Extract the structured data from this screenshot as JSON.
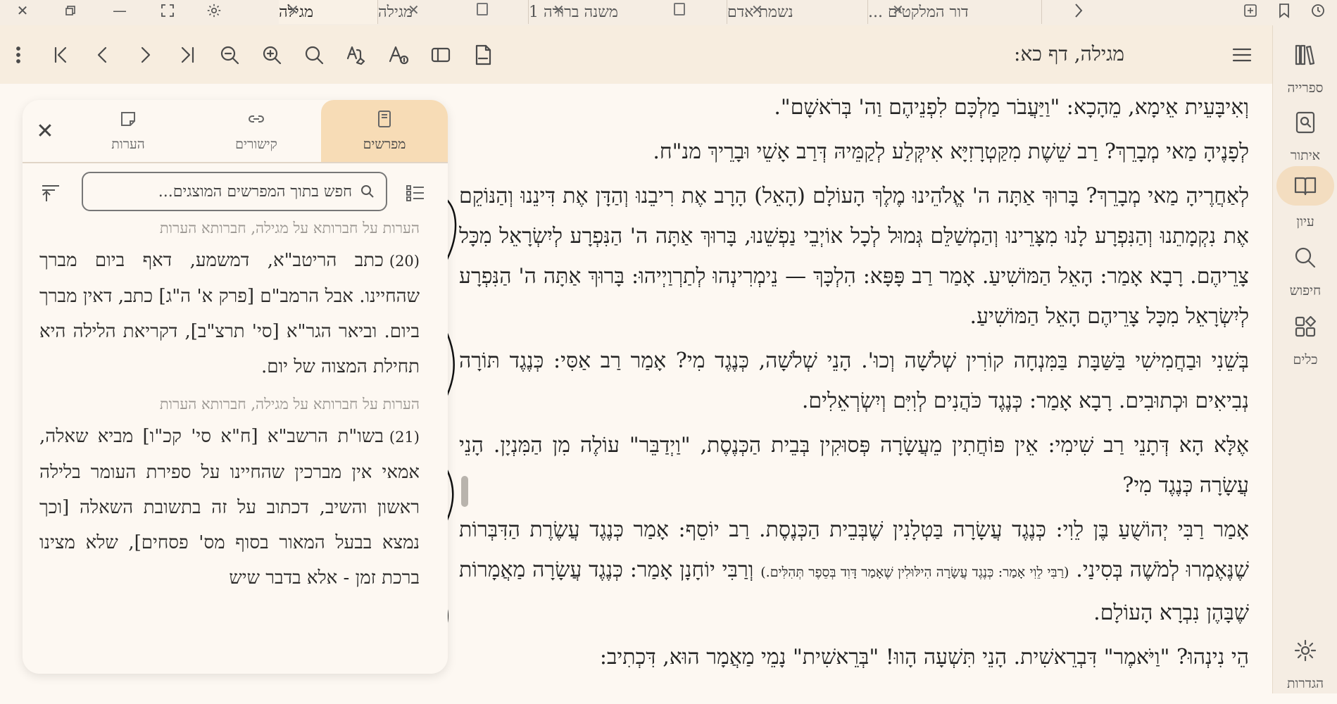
{
  "tabstrip": {
    "tabs": [
      {
        "label": "מגילה",
        "active": true
      },
      {
        "label": "מגילה",
        "active": false
      },
      {
        "label": "משנה ברורה 1",
        "active": false
      },
      {
        "label": "נשמת אדם",
        "active": false
      },
      {
        "label": "דור המלקטים ...",
        "active": false
      }
    ]
  },
  "toolbar": {
    "title": "מגילה, דף כא:"
  },
  "rail": {
    "items": [
      {
        "label": "ספרייה",
        "icon": "library-icon"
      },
      {
        "label": "איתור",
        "icon": "locate-icon"
      },
      {
        "label": "עיון",
        "icon": "study-icon"
      },
      {
        "label": "חיפוש",
        "icon": "search-icon"
      },
      {
        "label": "כלים",
        "icon": "tools-icon"
      }
    ],
    "settings_label": "הגדרות"
  },
  "panel": {
    "tabs": [
      {
        "label": "מפרשים",
        "active": true
      },
      {
        "label": "קישורים",
        "active": false
      },
      {
        "label": "הערות",
        "active": false
      }
    ],
    "search_placeholder": "חפש בתוך המפרשים המוצגים...",
    "entries": [
      {
        "source": "הערות על חברותא על מגילה, חברותא הערות",
        "number": "(20)",
        "text": "כתב הריטב\"א, דמשמע, דאף ביום מברך שהחיינו. אבל הרמב\"ם [פרק א' ה\"ג] כתב, דאין מברך ביום. וביאר הגר\"א [סי' תרצ\"ב], דקריאת הלילה היא תחילת המצוה של יום."
      },
      {
        "source": "הערות על חברותא על מגילה, חברותא הערות",
        "number": "(21)",
        "text": "בשו\"ת הרשב\"א [ח\"א סי' קכ\"ו] מביא שאלה, אמאי אין מברכין שהחיינו על ספירת העומר בלילה ראשון והשיב, דכתוב על זה בתשובת השאלה [וכך נמצא בבעל המאור בסוף מס' פסחים], שלא מצינו ברכת זמן - אלא בדבר שיש"
      }
    ]
  },
  "main": {
    "paragraphs": [
      "וְאִיבָּעֵית אֵימָא, מֵהָכָא: \"וַיַּעֲבֹר מַלְכָּם לִפְנֵיהֶם וַה' בְּרֹאשָׁם\".",
      "לְפָנֶיהָ מַאי מְבָרֵךְ? רַב שֵׁשֶׁת מִקַּטְרָזִיָּא אִיקְּלַע לְקַמֵּיהּ דְּרַב אָשֵׁי וּבָרֵיךְ מנ\"ח.",
      "לְאַחֲרֶיהָ מַאי מְבָרֵךְ? בָּרוּךְ אַתָּה ה' אֱלֹהֵינוּ מֶלֶךְ הָעוֹלָם (הָאֵל) הָרָב אֶת רִיבֵנוּ וְהַדָּן אֶת דִּינֵנוּ וְהַנּוֹקֵם אֶת נִקְמָתֵנוּ וְהַנִּפְרָע לָנוּ מִצָּרֵינוּ וְהַמְשַׁלֵּם גְּמוּל לְכָל אוֹיְבֵי נַפְשֵׁנוּ, בָּרוּךְ אַתָּה ה' הַנִּפְרָע לְיִשְׂרָאֵל מִכָּל צָרֵיהֶם. רָבָא אָמַר: הָאֵל הַמּוֹשִׁיעַ. אָמַר רַב פָּפָּא: הִלְכָּךְ — נֵימְרִינְהוּ לְתַרְוַיְיהוּ: בָּרוּךְ אַתָּה ה' הַנִּפְרָע לְיִשְׂרָאֵל מִכָּל צָרֵיהֶם הָאֵל הַמּוֹשִׁיעַ.",
      "בְּשֵׁנִי וּבַחֲמִישִׁי בַּשַּׁבָּת בַּמִּנְחָה קוֹרִין שְׁלֹשָׁה וְכוּ'. הָנֵי שְׁלֹשָׁה, כְּנֶגֶד מִי? אָמַר רַב אַסִּי: כְּנֶגֶד תּוֹרָה נְבִיאִים וּכְתוּבִים. רָבָא אָמַר: כְּנֶגֶד כֹּהֲנִים לְוִיִּם וְיִשְׂרְאֵלִים.",
      "אֶלָּא הָא דְּתָנֵי רַב שִׁימִי: אֵין פּוֹחֲתִין מֵעֲשָׂרָה פְּסוּקִין בְּבֵית הַכְּנֶסֶת, \"וַיְדַבֵּר\" עוֹלֶה מִן הַמִּנְיָן. הָנֵי עֲשָׂרָה כְּנֶגֶד מִי?",
      "אָמַר רַבִּי יְהוֹשֻׁעַ בֶּן לֵוִי: כְּנֶגֶד עֲשָׂרָה בַּטְלָנִין שֶׁבְּבֵית הַכְּנֶסֶת. רַב יוֹסֵף: אָמַר כְּנֶגֶד עֲשֶׂרֶת הַדִּבְּרוֹת שֶׁנֶּאֶמְרוּ לְמֹשֶׁה בְּסִינַי.",
      "וְרַבִּי יוֹחָנָן אָמַר: כְּנֶגֶד עֲשָׂרָה מַאֲמָרוֹת שֶׁבָּהֶן נִבְרָא הָעוֹלָם.",
      "הֵי נִינְהוּ? \"וַיֹּאמֶר\" דִּבְרֵאשִׁית. הָנֵי תִּשְׁעָה הָווּ! \"בְּרֵאשִׁית\" נָמֵי מַאֲמָר הוּא, דִּכְתִיב:"
    ],
    "small_note": "(רַבִּי לֵוִי אָמַר: כְּנֶגֶד עֲשָׂרָה הִילּוּלִין שֶׁאָמַר דָּוִד בְּסֵפֶר תְּהִלִּים.)"
  }
}
